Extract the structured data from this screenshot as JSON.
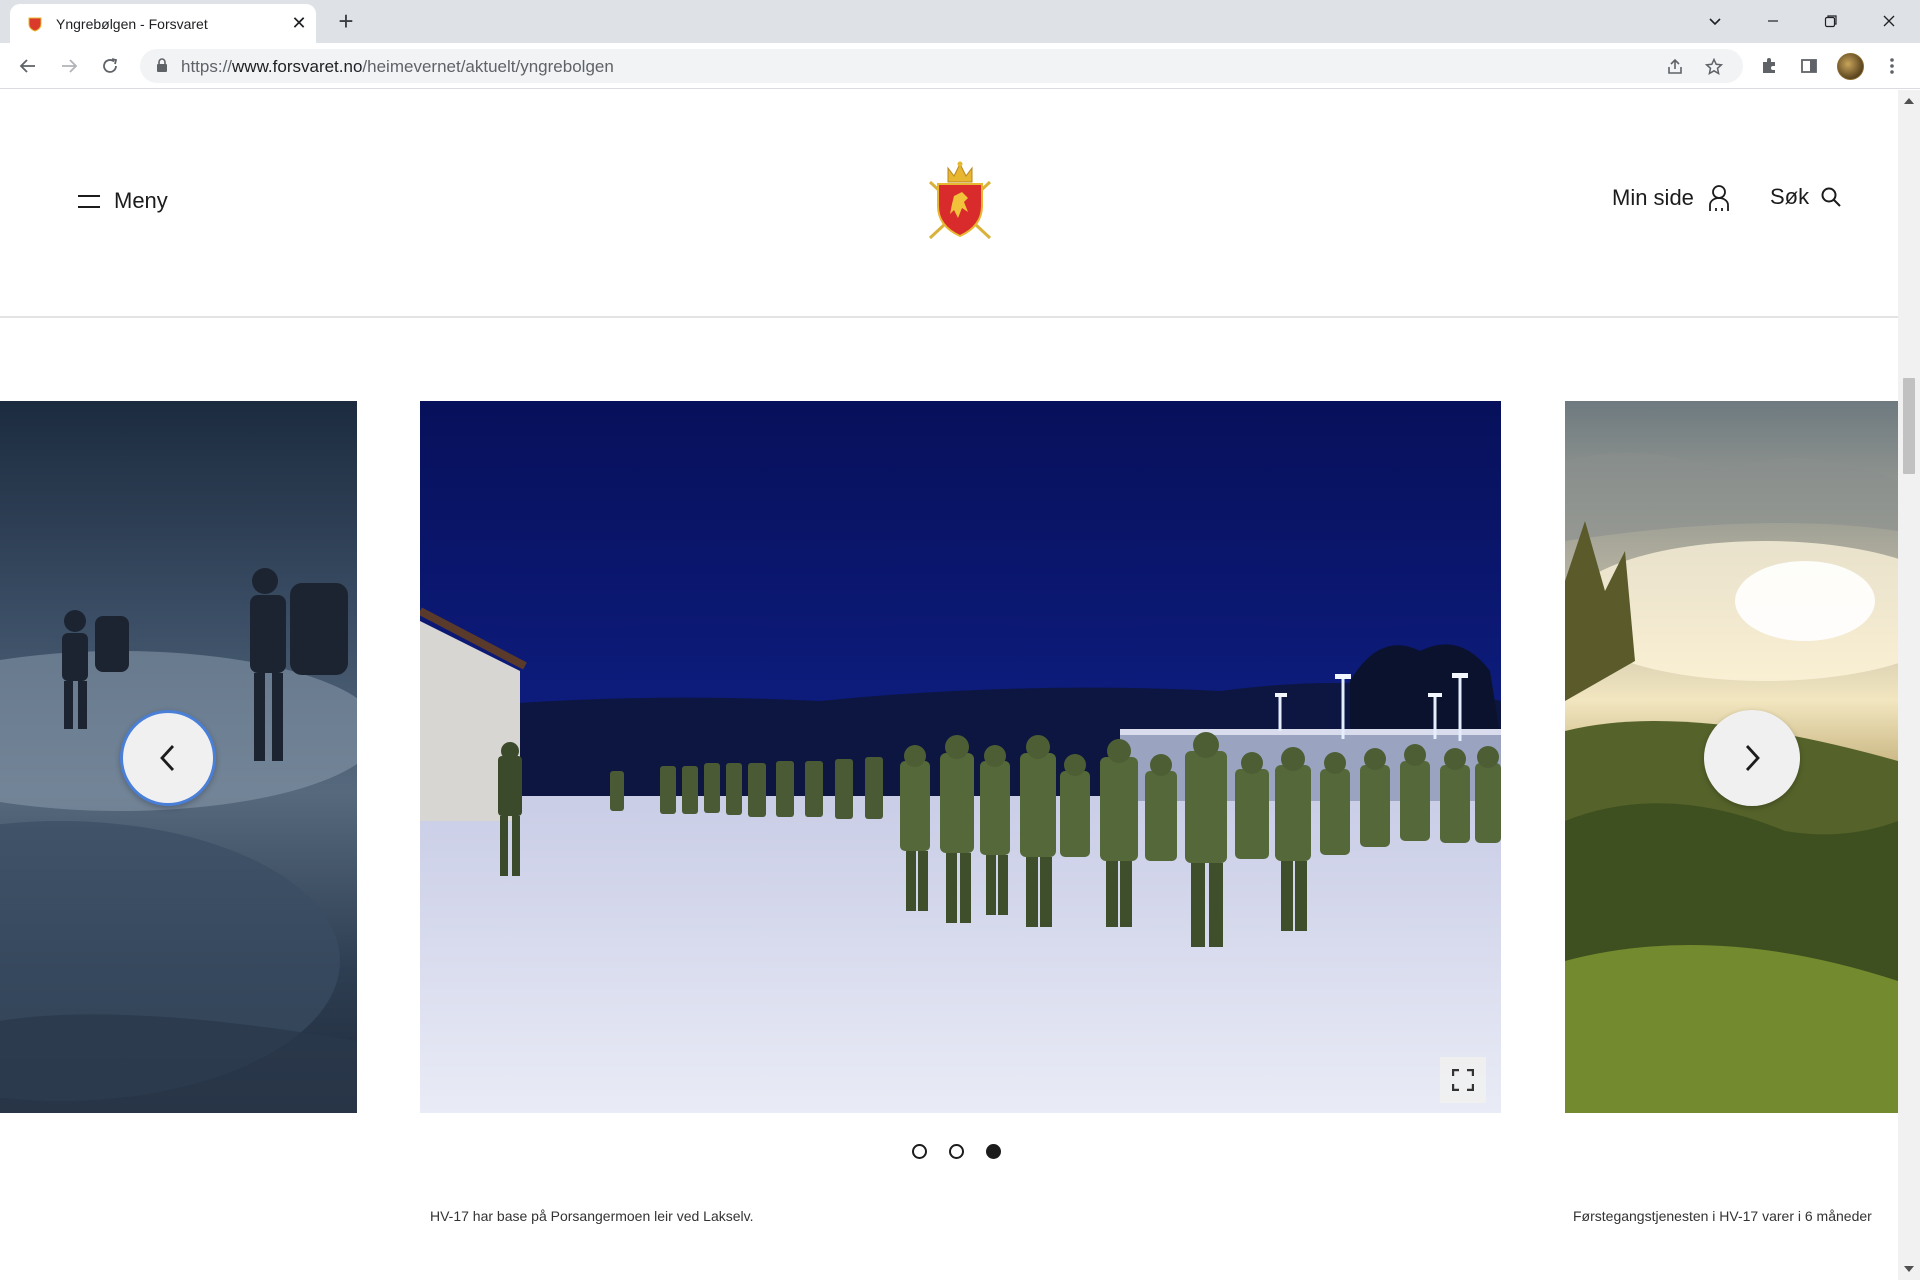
{
  "browser": {
    "tab_title": "Yngrebølgen - Forsvaret",
    "url_scheme": "https://",
    "url_host": "www.forsvaret.no",
    "url_path": "/heimevernet/aktuelt/yngrebolgen"
  },
  "header": {
    "menu_label": "Meny",
    "min_side_label": "Min side",
    "search_label": "Søk"
  },
  "carousel": {
    "dots": [
      {
        "active": false
      },
      {
        "active": false
      },
      {
        "active": true
      }
    ],
    "captions": {
      "center": "HV-17 har base på Porsangermoen leir ved Lakselv.",
      "right": "Førstegangstjenesten i HV-17 varer i 6 måneder"
    }
  },
  "colors": {
    "tabbar_bg": "#dee1e6",
    "text": "#1c1c1c",
    "focus_ring": "#4a7fd8"
  }
}
